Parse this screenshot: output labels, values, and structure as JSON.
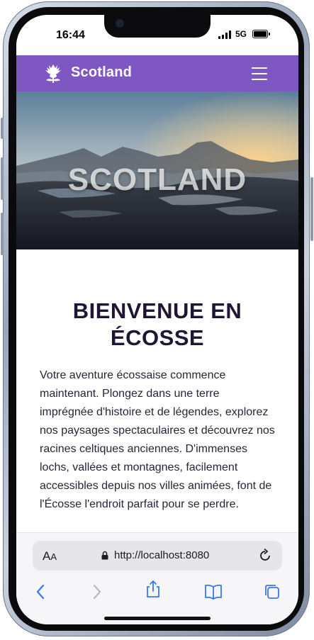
{
  "status": {
    "time": "16:44",
    "network": "5G"
  },
  "navbar": {
    "brand": "Scotland",
    "logo_icon": "thistle-icon",
    "menu_icon": "hamburger-menu-icon"
  },
  "hero": {
    "overlay_text": "SCOTLAND"
  },
  "main": {
    "heading_line1": "BIENVENUE EN",
    "heading_line2": "ÉCOSSE",
    "intro": "Votre aventure écossaise commence maintenant. Plongez dans une terre imprégnée d'histoire et de légendes, explorez nos paysages spectaculaires et découvrez nos racines celtiques anciennes. D'immenses lochs, vallées et montagnes, facilement accessibles depuis nos villes animées, font de l'Écosse l'endroit parfait pour se perdre."
  },
  "browser": {
    "text_size_label": "A",
    "text_size_label_small": "A",
    "url": "http://localhost:8080",
    "icons": [
      "lock-icon",
      "reload-icon",
      "back-icon",
      "forward-icon",
      "share-icon",
      "bookmarks-icon",
      "tabs-icon"
    ]
  },
  "colors": {
    "nav_purple": "#7e57c2",
    "heading": "#1f1534",
    "body_text": "#2a2438"
  }
}
